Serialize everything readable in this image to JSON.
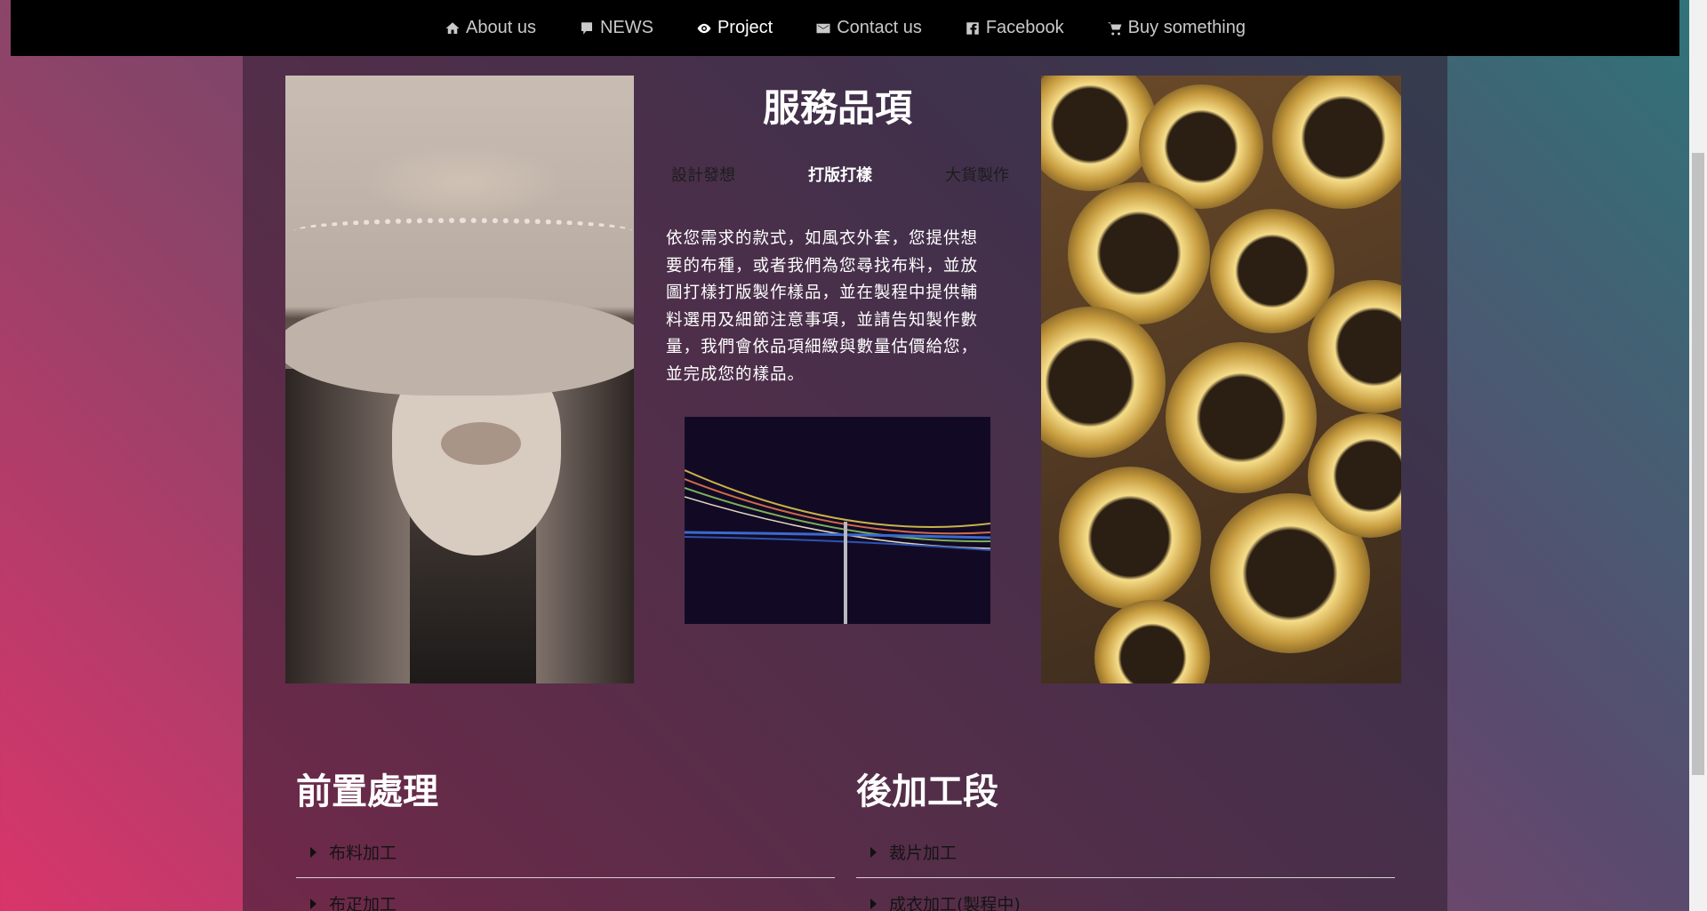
{
  "nav": {
    "items": [
      {
        "label": "About us",
        "icon": "home-icon",
        "active": false
      },
      {
        "label": "NEWS",
        "icon": "speech-bubble-icon",
        "active": false
      },
      {
        "label": "Project",
        "icon": "eye-icon",
        "active": true
      },
      {
        "label": "Contact us",
        "icon": "mail-icon",
        "active": false
      },
      {
        "label": "Facebook",
        "icon": "facebook-icon",
        "active": false
      },
      {
        "label": "Buy something",
        "icon": "cart-icon",
        "active": false
      }
    ]
  },
  "services": {
    "title": "服務品項",
    "tabs": [
      {
        "label": "設計發想",
        "active": false
      },
      {
        "label": "打版打樣",
        "active": true
      },
      {
        "label": "大貨製作",
        "active": false
      }
    ],
    "description": "依您需求的款式，如風衣外套，您提供想要的布種，或者我們為您尋找布料，並放圖打樣打版製作樣品，並在製程中提供輔料選用及細節注意事項，並請告知製作數量，我們會依品項細緻與數量估價給您，並完成您的樣品。"
  },
  "pre_processing": {
    "title": "前置處理",
    "items": [
      "布料加工",
      "布疋加工"
    ]
  },
  "post_processing": {
    "title": "後加工段",
    "items": [
      "裁片加工",
      "成衣加工(製程中)"
    ]
  },
  "colors": {
    "nav_bg": "#000000",
    "nav_text": "#c9c9c9",
    "nav_active": "#ffffff",
    "gradient_pink": "#d9356a",
    "gradient_teal": "#2f7478"
  }
}
